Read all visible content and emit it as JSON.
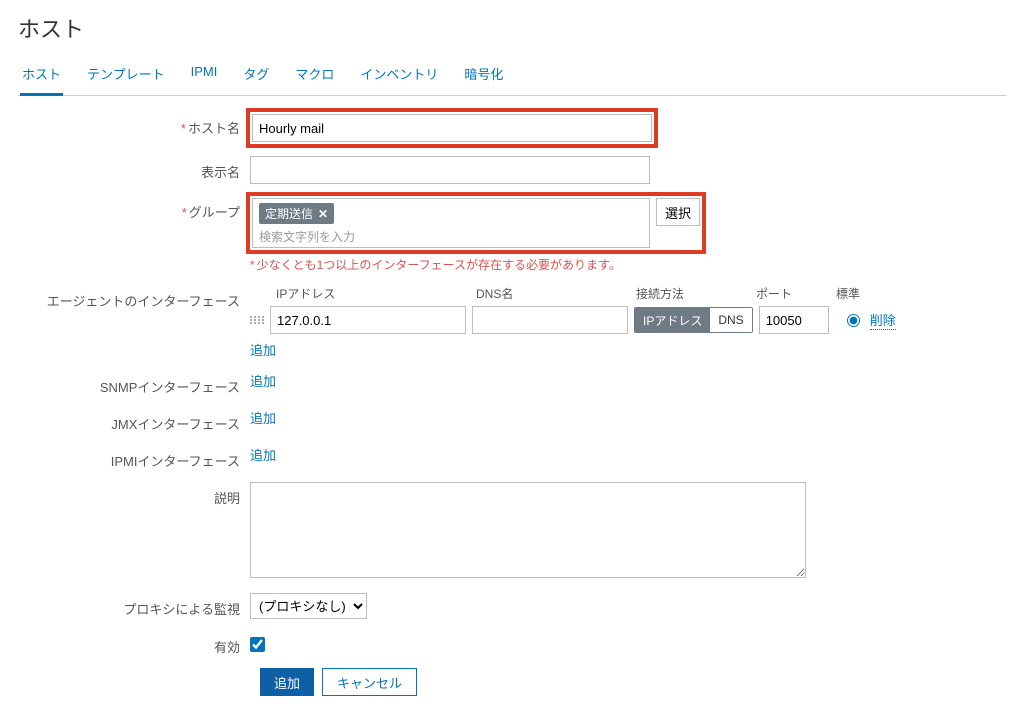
{
  "page_title": "ホスト",
  "tabs": [
    "ホスト",
    "テンプレート",
    "IPMI",
    "タグ",
    "マクロ",
    "インベントリ",
    "暗号化"
  ],
  "active_tab": 0,
  "labels": {
    "host_name": "ホスト名",
    "visible_name": "表示名",
    "groups": "グループ",
    "agent_iface": "エージェントのインターフェース",
    "snmp_iface": "SNMPインターフェース",
    "jmx_iface": "JMXインターフェース",
    "ipmi_iface": "IPMIインターフェース",
    "description": "説明",
    "proxy": "プロキシによる監視",
    "enabled": "有効"
  },
  "fields": {
    "host_name": "Hourly mail",
    "visible_name": "",
    "group_tag": "定期送信",
    "group_placeholder": "検索文字列を入力",
    "select_btn": "選択",
    "iface_warning": "少なくとも1つ以上のインターフェースが存在する必要があります。",
    "proxy_value": "(プロキシなし)",
    "enabled_checked": true
  },
  "iface_headers": {
    "ip": "IPアドレス",
    "dns": "DNS名",
    "conn": "接続方法",
    "port": "ポート",
    "default": "標準"
  },
  "agent_iface": {
    "ip": "127.0.0.1",
    "dns": "",
    "conn_ip": "IPアドレス",
    "conn_dns": "DNS",
    "port": "10050",
    "delete": "削除"
  },
  "add_link": "追加",
  "actions": {
    "submit": "追加",
    "cancel": "キャンセル"
  }
}
